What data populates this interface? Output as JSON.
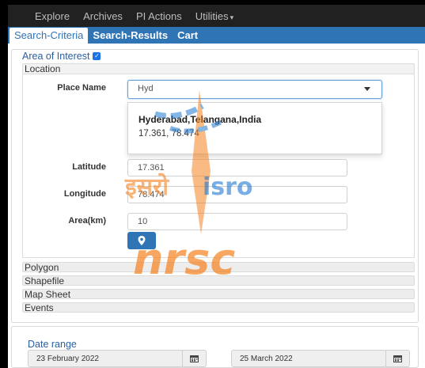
{
  "nav": {
    "items": [
      "Explore",
      "Archives",
      "PI Actions",
      "Utilities"
    ]
  },
  "tabs": [
    "Search-Criteria",
    "Search-Results",
    "Cart"
  ],
  "aoi": {
    "label": "Area of Interest",
    "checked": true,
    "location_title": "Location",
    "place_name_label": "Place Name",
    "place_name_value": "Hyd",
    "suggestion": {
      "name": "Hyderabad,Telangana,India",
      "coords": "17.361, 78.474"
    },
    "latitude_label": "Latitude",
    "latitude_value": "17.361",
    "longitude_label": "Longitude",
    "longitude_value": "78.474",
    "area_label": "Area(km)",
    "area_value": "10",
    "sections": [
      "Polygon",
      "Shapefile",
      "Map Sheet",
      "Events"
    ]
  },
  "date_range": {
    "label": "Date range",
    "from": "23 February 2022",
    "to": "25 March 2022"
  },
  "watermark": {
    "hindi": "इसरो",
    "isro": "isro",
    "nrsc": "nrsc"
  },
  "colors": {
    "accent": "#2f74b5",
    "nav_bg": "#212121",
    "watermark_orange": "#f58220",
    "watermark_blue": "#1f7ad1"
  },
  "icons": {
    "map_button": "map-marker-icon",
    "calendar": "calendar-icon",
    "dropdown": "caret-down-icon"
  }
}
